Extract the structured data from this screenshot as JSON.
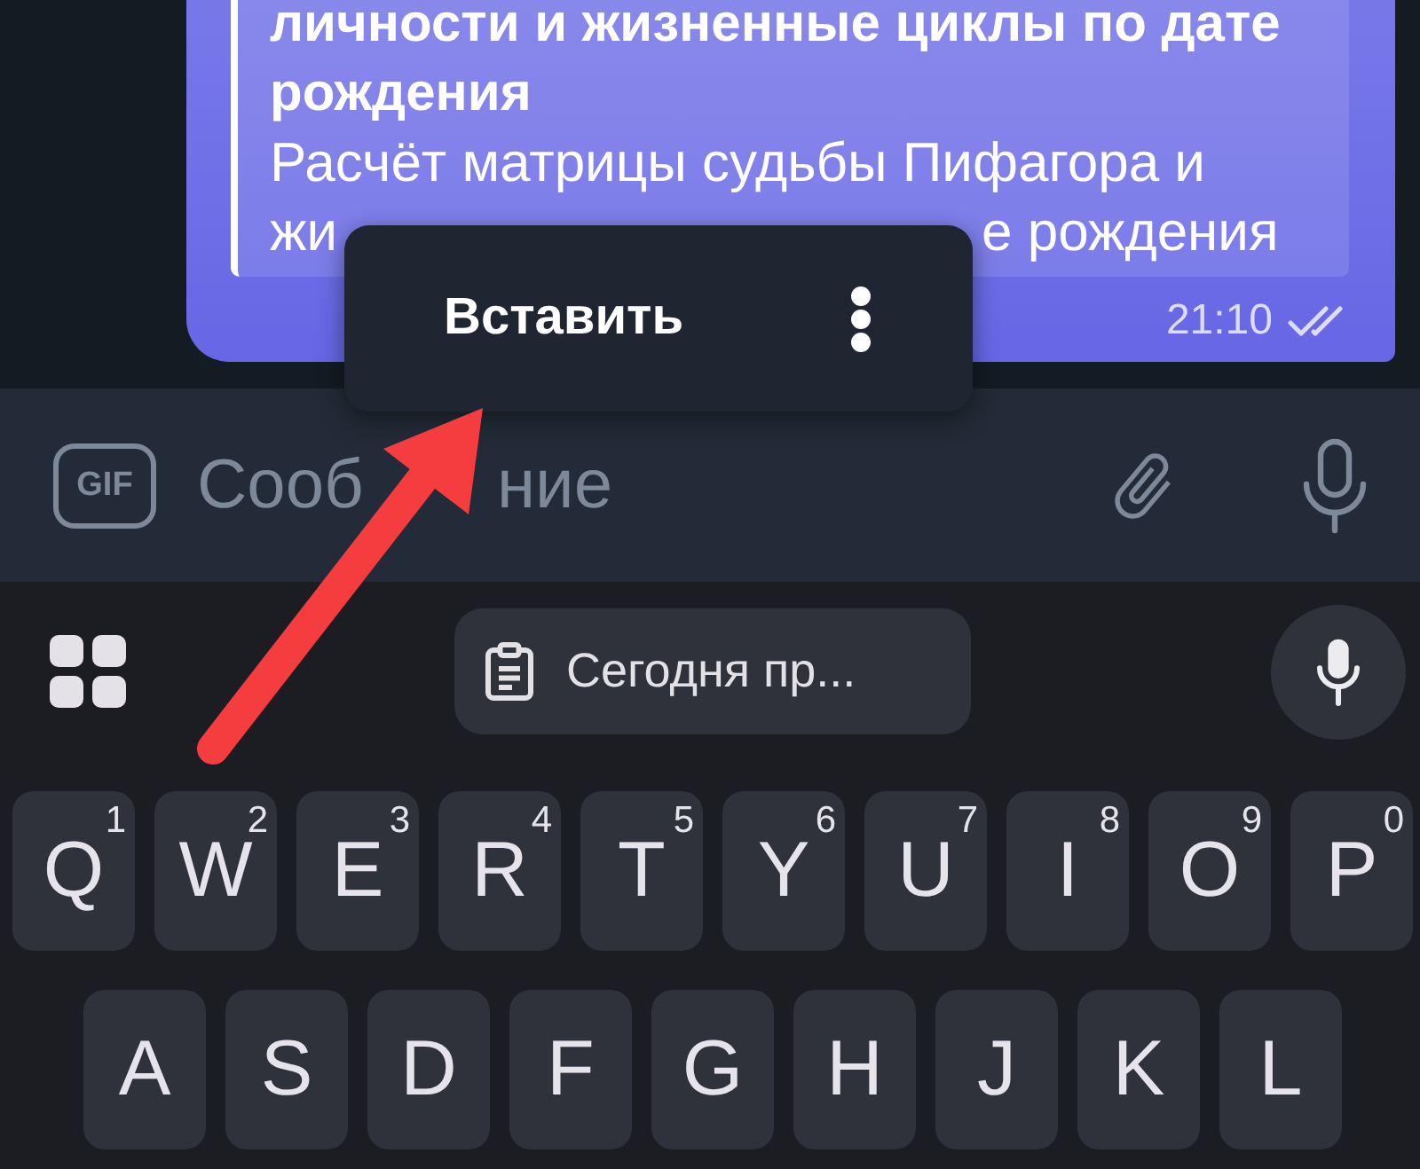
{
  "chat": {
    "message": {
      "link_preview": {
        "title": "личности и жизненные циклы по дате рождения",
        "description_lines": [
          {
            "kind": "full",
            "text": "Расчёт матрицы судьбы Пифагора и"
          },
          {
            "kind": "split",
            "left": "жи",
            "right": "е рождения"
          }
        ]
      },
      "time": "21:10",
      "read": true
    }
  },
  "paste_menu": {
    "label": "Вставить"
  },
  "composer": {
    "gif_label": "GIF",
    "placeholder": {
      "left": "Сооб",
      "right": "ние"
    }
  },
  "keyboard": {
    "clipboard_suggestion": "Сегодня пр...",
    "rows": [
      {
        "keys": [
          {
            "letter": "Q",
            "hint": "1"
          },
          {
            "letter": "W",
            "hint": "2"
          },
          {
            "letter": "E",
            "hint": "3"
          },
          {
            "letter": "R",
            "hint": "4"
          },
          {
            "letter": "T",
            "hint": "5"
          },
          {
            "letter": "Y",
            "hint": "6"
          },
          {
            "letter": "U",
            "hint": "7"
          },
          {
            "letter": "I",
            "hint": "8"
          },
          {
            "letter": "O",
            "hint": "9"
          },
          {
            "letter": "P",
            "hint": "0"
          }
        ]
      },
      {
        "keys": [
          {
            "letter": "A"
          },
          {
            "letter": "S"
          },
          {
            "letter": "D"
          },
          {
            "letter": "F"
          },
          {
            "letter": "G"
          },
          {
            "letter": "H"
          },
          {
            "letter": "J"
          },
          {
            "letter": "K"
          },
          {
            "letter": "L"
          }
        ]
      }
    ]
  }
}
